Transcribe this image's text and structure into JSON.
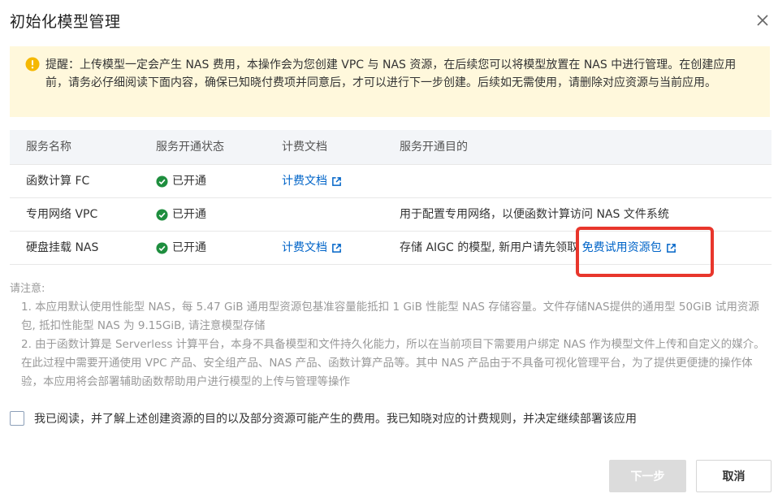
{
  "dialog": {
    "title": "初始化模型管理",
    "close_icon": "close-icon"
  },
  "notice": {
    "icon": "warning-icon",
    "text": "提醒：上传模型一定会产生 NAS 费用，本操作会为您创建 VPC 与 NAS 资源，在后续您可以将模型放置在 NAS 中进行管理。在创建应用前，请务必仔细阅读下面内容，确保已知晓付费项并同意后，才可以进行下一步创建。后续如无需使用，请删除对应资源与当前应用。",
    "background": "#fff8dc"
  },
  "table": {
    "headers": [
      "服务名称",
      "服务开通状态",
      "计费文档",
      "服务开通目的"
    ],
    "rows": [
      {
        "name": "函数计算 FC",
        "status": "已开通",
        "billing": "计费文档",
        "purpose": "",
        "purpose_link": ""
      },
      {
        "name": "专用网络 VPC",
        "status": "已开通",
        "billing": "",
        "purpose": "用于配置专用网络，以便函数计算访问 NAS 文件系统",
        "purpose_link": ""
      },
      {
        "name": "硬盘挂载 NAS",
        "status": "已开通",
        "billing": "计费文档",
        "purpose": "存储 AIGC 的模型, 新用户请先领取",
        "purpose_link": "免费试用资源包"
      }
    ]
  },
  "notes": {
    "title": "请注意:",
    "items": [
      "1. 本应用默认使用性能型 NAS，每 5.47 GiB 通用型资源包基准容量能抵扣 1 GiB 性能型 NAS 存储容量。文件存储NAS提供的通用型 50GiB 试用资源包, 抵扣性能型 NAS 为 9.15GiB, 请注意模型存储",
      "2. 由于函数计算是 Serverless 计算平台，本身不具备模型和文件持久化能力，所以在当前项目下需要用户绑定 NAS 作为模型文件上传和自定义的媒介。在此过程中需要开通使用 VPC 产品、安全组产品、NAS 产品、函数计算产品等。其中 NAS 产品由于不具备可视化管理平台，为了提供更便捷的操作体验，本应用将会部署辅助函数帮助用户进行模型的上传与管理等操作"
    ]
  },
  "agree": {
    "checked": false,
    "label": "我已阅读，并了解上述创建资源的目的以及部分资源可能产生的费用。我已知晓对应的计费规则，并决定继续部署该应用"
  },
  "buttons": {
    "next": "下一步",
    "cancel": "取消"
  },
  "colors": {
    "link": "#0064c8",
    "success": "#1e8e3e",
    "highlight": "#e8362c",
    "warning": "#f5b800"
  }
}
